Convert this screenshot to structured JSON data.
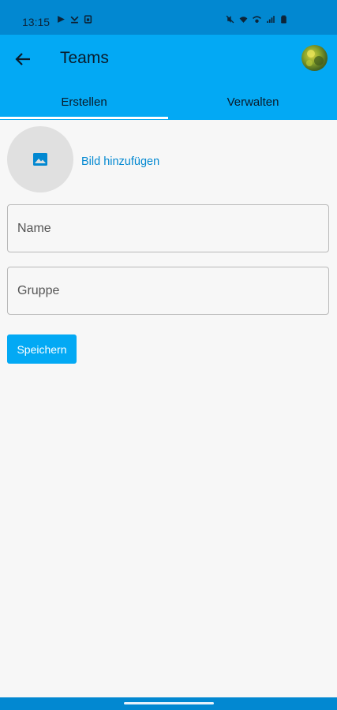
{
  "status_bar": {
    "time": "13:15",
    "left_icons": [
      "play-icon",
      "missed-call-icon",
      "sim-icon"
    ],
    "right_icons": [
      "mute-icon",
      "wifi-icon",
      "wifi-call-icon",
      "signal-icon",
      "battery-icon"
    ]
  },
  "app_bar": {
    "back_icon": "arrow-left-icon",
    "title": "Teams",
    "avatar": "user-avatar"
  },
  "tabs": [
    {
      "label": "Erstellen",
      "selected": true
    },
    {
      "label": "Verwalten",
      "selected": false
    }
  ],
  "form": {
    "image_picker": {
      "icon": "image-icon",
      "link_label": "Bild hinzufügen"
    },
    "name_field": {
      "placeholder": "Name",
      "value": ""
    },
    "group_field": {
      "placeholder": "Gruppe",
      "value": ""
    },
    "save_label": "Speichern"
  },
  "colors": {
    "status_bar": "#0288d1",
    "app_bar": "#03a9f4",
    "accent": "#03a9f4",
    "link": "#0288d1",
    "background": "#f7f7f7"
  }
}
